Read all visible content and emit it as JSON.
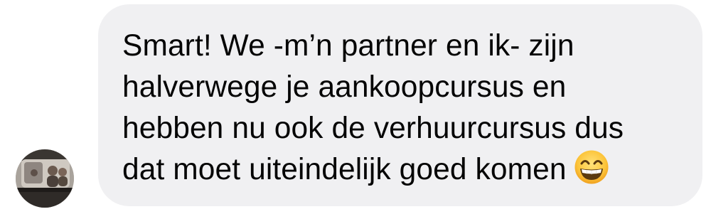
{
  "message": {
    "lines": [
      "Smart! We -m’n partner en ik- zijn",
      "halverwege je aankoopcursus en",
      "hebben nu ook de verhuurcursus dus",
      "dat moet uiteindelijk goed komen"
    ],
    "emoji": "grinning-face-with-smiling-eyes",
    "bubble_color": "#f0f0f2",
    "text_color": "#050505"
  },
  "sender": {
    "avatar": "profile-photo"
  }
}
